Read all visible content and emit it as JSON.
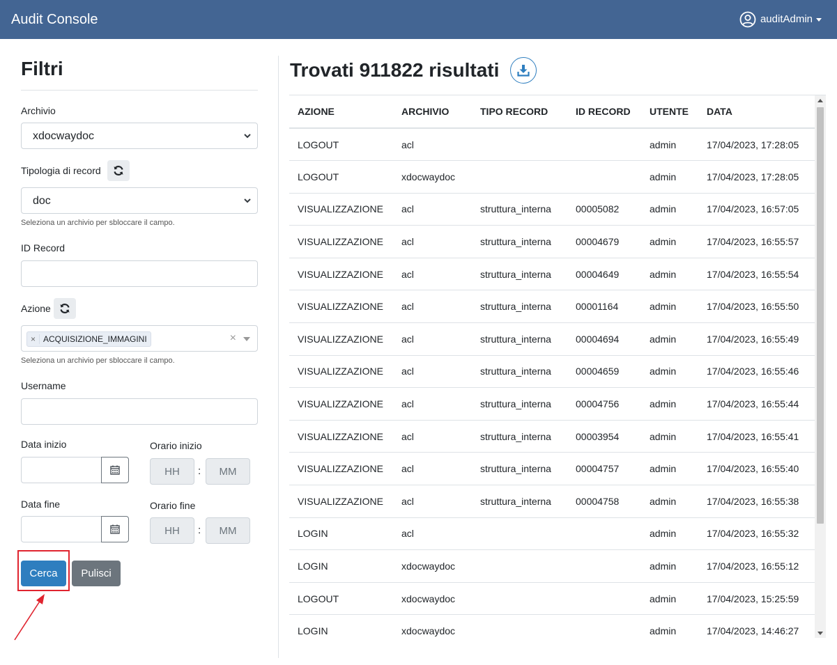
{
  "header": {
    "app_title": "Audit Console",
    "user_name": "auditAdmin"
  },
  "filters": {
    "title": "Filtri",
    "archivio": {
      "label": "Archivio",
      "value": "xdocwaydoc"
    },
    "tipologia": {
      "label": "Tipologia di record",
      "value": "doc",
      "help": "Seleziona un archivio per sbloccare il campo."
    },
    "id_record": {
      "label": "ID Record",
      "value": ""
    },
    "azione": {
      "label": "Azione",
      "tag": "ACQUISIZIONE_IMMAGINI",
      "clear": "×",
      "tag_remove": "×",
      "help": "Seleziona un archivio per sbloccare il campo."
    },
    "username": {
      "label": "Username",
      "value": ""
    },
    "data_inizio": {
      "label": "Data inizio"
    },
    "orario_inizio": {
      "label": "Orario inizio",
      "hh": "HH",
      "mm": "MM",
      "sep": ":"
    },
    "data_fine": {
      "label": "Data fine"
    },
    "orario_fine": {
      "label": "Orario fine",
      "hh": "HH",
      "mm": "MM",
      "sep": ":"
    },
    "search_label": "Cerca",
    "clear_label": "Pulisci"
  },
  "results": {
    "title": "Trovati 911822 risultati",
    "columns": [
      "AZIONE",
      "ARCHIVIO",
      "TIPO RECORD",
      "ID RECORD",
      "UTENTE",
      "DATA"
    ],
    "rows": [
      [
        "LOGOUT",
        "acl",
        "",
        "",
        "admin",
        "17/04/2023, 17:28:05"
      ],
      [
        "LOGOUT",
        "xdocwaydoc",
        "",
        "",
        "admin",
        "17/04/2023, 17:28:05"
      ],
      [
        "VISUALIZZAZIONE",
        "acl",
        "struttura_interna",
        "00005082",
        "admin",
        "17/04/2023, 16:57:05"
      ],
      [
        "VISUALIZZAZIONE",
        "acl",
        "struttura_interna",
        "00004679",
        "admin",
        "17/04/2023, 16:55:57"
      ],
      [
        "VISUALIZZAZIONE",
        "acl",
        "struttura_interna",
        "00004649",
        "admin",
        "17/04/2023, 16:55:54"
      ],
      [
        "VISUALIZZAZIONE",
        "acl",
        "struttura_interna",
        "00001164",
        "admin",
        "17/04/2023, 16:55:50"
      ],
      [
        "VISUALIZZAZIONE",
        "acl",
        "struttura_interna",
        "00004694",
        "admin",
        "17/04/2023, 16:55:49"
      ],
      [
        "VISUALIZZAZIONE",
        "acl",
        "struttura_interna",
        "00004659",
        "admin",
        "17/04/2023, 16:55:46"
      ],
      [
        "VISUALIZZAZIONE",
        "acl",
        "struttura_interna",
        "00004756",
        "admin",
        "17/04/2023, 16:55:44"
      ],
      [
        "VISUALIZZAZIONE",
        "acl",
        "struttura_interna",
        "00003954",
        "admin",
        "17/04/2023, 16:55:41"
      ],
      [
        "VISUALIZZAZIONE",
        "acl",
        "struttura_interna",
        "00004757",
        "admin",
        "17/04/2023, 16:55:40"
      ],
      [
        "VISUALIZZAZIONE",
        "acl",
        "struttura_interna",
        "00004758",
        "admin",
        "17/04/2023, 16:55:38"
      ],
      [
        "LOGIN",
        "acl",
        "",
        "",
        "admin",
        "17/04/2023, 16:55:32"
      ],
      [
        "LOGIN",
        "xdocwaydoc",
        "",
        "",
        "admin",
        "17/04/2023, 16:55:12"
      ],
      [
        "LOGOUT",
        "xdocwaydoc",
        "",
        "",
        "admin",
        "17/04/2023, 15:25:59"
      ],
      [
        "LOGIN",
        "xdocwaydoc",
        "",
        "",
        "admin",
        "17/04/2023, 14:46:27"
      ]
    ]
  },
  "colors": {
    "navbar": "#436593",
    "primary": "#2e7ebf",
    "secondary": "#6c757d",
    "highlight": "#e0242f"
  },
  "icons": {
    "user": "user-circle-icon",
    "refresh": "refresh-icon",
    "calendar": "calendar-icon",
    "download": "download-icon"
  }
}
